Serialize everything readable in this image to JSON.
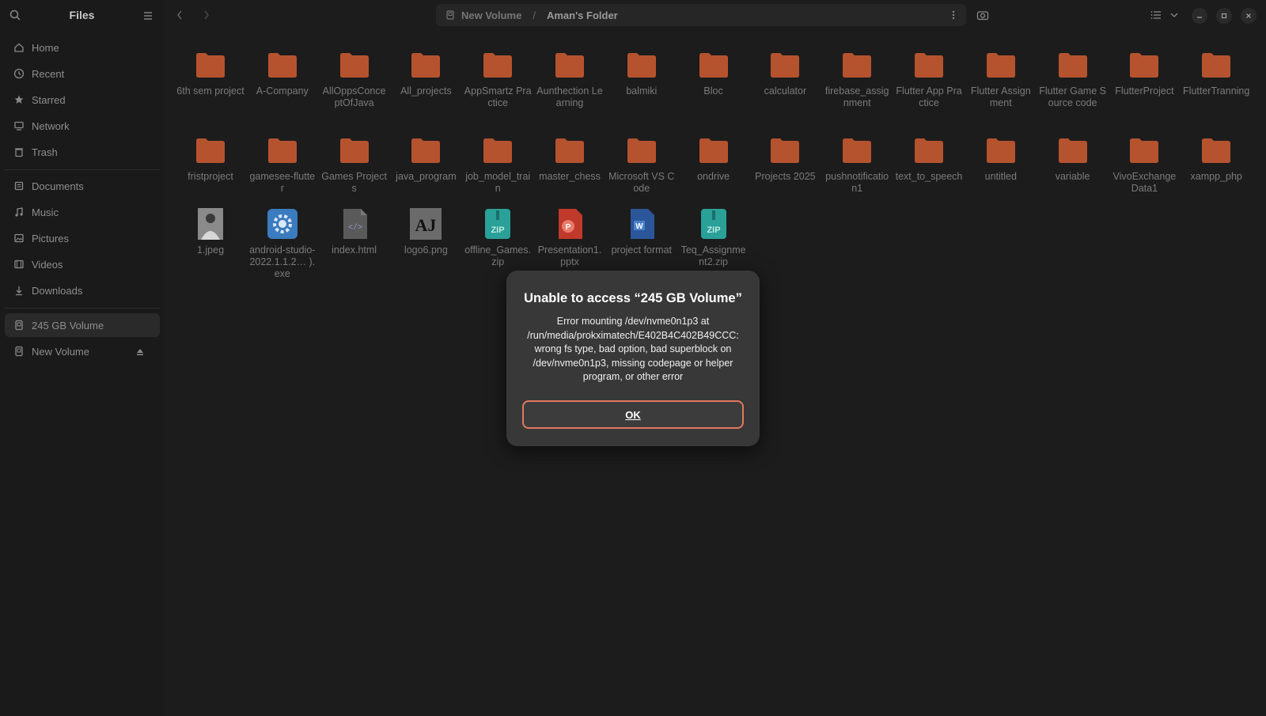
{
  "app": {
    "title": "Files"
  },
  "colors": {
    "folder": "#b5532f",
    "accent": "#e07a5f",
    "zip": "#2aa198",
    "pptx": "#c0392b",
    "docx": "#2b579a",
    "exe": "#3b7bbf"
  },
  "sidebar": {
    "items": [
      {
        "label": "Home",
        "icon": "home-icon"
      },
      {
        "label": "Recent",
        "icon": "clock-icon"
      },
      {
        "label": "Starred",
        "icon": "star-icon"
      },
      {
        "label": "Network",
        "icon": "network-icon"
      },
      {
        "label": "Trash",
        "icon": "trash-icon"
      }
    ],
    "places": [
      {
        "label": "Documents",
        "icon": "document-icon"
      },
      {
        "label": "Music",
        "icon": "music-icon"
      },
      {
        "label": "Pictures",
        "icon": "pictures-icon"
      },
      {
        "label": "Videos",
        "icon": "videos-icon"
      },
      {
        "label": "Downloads",
        "icon": "download-icon"
      }
    ],
    "drives": [
      {
        "label": "245 GB Volume",
        "icon": "drive-icon",
        "active": true
      },
      {
        "label": "New Volume",
        "icon": "drive-icon",
        "eject": true
      }
    ]
  },
  "path": {
    "segments": [
      "New Volume",
      "Aman's Folder"
    ],
    "separator": "/"
  },
  "files": {
    "row1": [
      "6th sem project",
      "A-Company",
      "AllOppsConceptOfJava",
      "All_projects",
      "AppSmartz Practice",
      "Aunthection Learning",
      "balmiki",
      "Bloc",
      "calculator",
      "firebase_assignment",
      "Flutter App Practice",
      "Flutter Assignment",
      "Flutter Game Source code",
      "FlutterProject",
      "FlutterTranning"
    ],
    "row2": [
      "fristproject",
      "gamesee-flutter",
      "Games Projects",
      "java_program",
      "job_model_train",
      "master_chess",
      "Microsoft VS Code",
      "ondrive",
      "Projects 2025",
      "pushnotification1",
      "text_to_speech",
      "untitled",
      "variable",
      "VivoExchangeData1",
      "xampp_php"
    ],
    "row3": [
      {
        "name": "1.jpeg",
        "type": "photo"
      },
      {
        "name": "android-studio-2022.1.1.2… ).exe",
        "type": "exe"
      },
      {
        "name": "index.html",
        "type": "html"
      },
      {
        "name": "logo6.png",
        "type": "png"
      },
      {
        "name": "offline_Games.zip",
        "type": "zip"
      },
      {
        "name": "Presentation1.pptx",
        "type": "pptx"
      },
      {
        "name": "project format",
        "type": "docx"
      },
      {
        "name": "Teq_Assignment2.zip",
        "type": "zip"
      }
    ]
  },
  "dialog": {
    "title": "Unable to access “245 GB Volume”",
    "message": "Error mounting /dev/nvme0n1p3 at /run/media/prokximatech/E402B4C402B49CCC: wrong fs type, bad option, bad superblock on /dev/nvme0n1p3, missing codepage or helper program, or other error",
    "ok_label": "OK"
  }
}
